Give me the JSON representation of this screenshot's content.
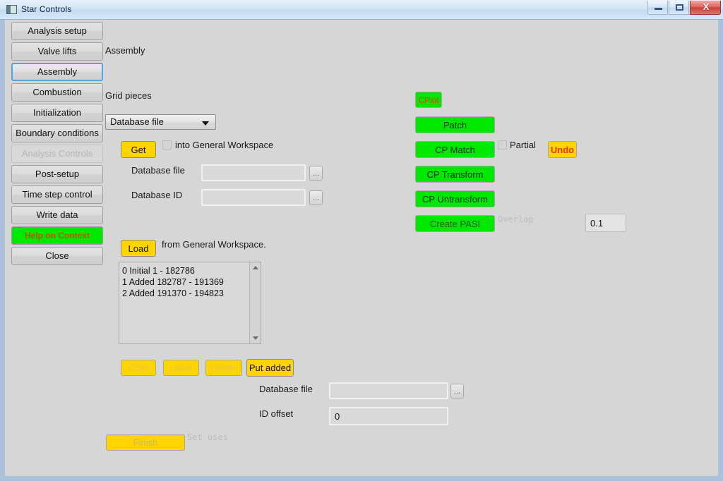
{
  "window": {
    "title": "Star Controls",
    "icon": "app-icon",
    "controls": {
      "minimize": "minimize-icon",
      "maximize": "maximize-icon",
      "close": "X"
    }
  },
  "sidebar": {
    "items": [
      {
        "label": "Analysis setup",
        "state": "normal"
      },
      {
        "label": "Valve lifts",
        "state": "normal"
      },
      {
        "label": "Assembly",
        "state": "selected"
      },
      {
        "label": "Combustion",
        "state": "normal"
      },
      {
        "label": "Initialization",
        "state": "normal"
      },
      {
        "label": "Boundary conditions",
        "state": "normal"
      },
      {
        "label": "Analysis Controls",
        "state": "disabled"
      },
      {
        "label": "Post-setup",
        "state": "normal"
      },
      {
        "label": "Time step control",
        "state": "normal"
      },
      {
        "label": "Write data",
        "state": "normal"
      },
      {
        "label": "Help on Context",
        "state": "help"
      },
      {
        "label": "Close",
        "state": "normal"
      }
    ]
  },
  "main": {
    "page_title": "Assembly",
    "grid_pieces_label": "Grid pieces",
    "source_select": {
      "value": "Database file",
      "options": [
        "Database file"
      ]
    },
    "get_button": "Get",
    "into_workspace_label": "into General Workspace",
    "into_workspace_checked": false,
    "database_file_label": "Database file",
    "database_file_value": "",
    "database_id_label": "Database ID",
    "database_id_value": "",
    "browse_label": "...",
    "load_button": "Load",
    "load_caption": "from General Workspace.",
    "list_items": [
      "0 Initial 1 - 182786",
      "1 Added 182787 - 191369",
      "2 Added 191370 - 194823"
    ],
    "action_buttons": [
      {
        "label": "CSet",
        "style": "dim"
      },
      {
        "label": "Label",
        "style": "dim"
      },
      {
        "label": "Delete",
        "style": "dim"
      },
      {
        "label": "Put added",
        "style": "strong"
      }
    ],
    "out_database_file_label": "Database file",
    "out_database_file_value": "",
    "id_offset_label": "ID offset",
    "id_offset_value": "0",
    "finish_button": "Finish",
    "set_uses_label": "Set uses"
  },
  "right_panel": {
    "cplot_button": "CPlot",
    "buttons": [
      "Patch",
      "CP Match",
      "CP Transform",
      "CP Untransform",
      "Create PASI"
    ],
    "partial_label": "Partial",
    "partial_checked": false,
    "undo_button": "Undo",
    "overlap_label": "Overlap",
    "overlap_value": "0.1"
  },
  "colors": {
    "window_bg": "#d6d6d6",
    "accent_yellow": "#ffd400",
    "accent_green": "#00e800",
    "help_text": "#c85000",
    "undo_text": "#e23a00",
    "frame_blue": "#a9c2da"
  }
}
